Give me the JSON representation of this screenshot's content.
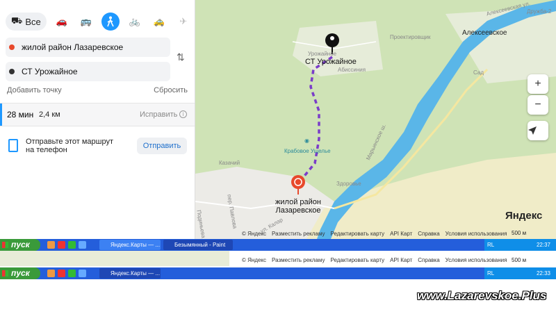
{
  "modes": {
    "all_label": "Все"
  },
  "route_from": "жилой район Лазаревское",
  "route_to": "СТ Урожайное",
  "add_point": "Добавить точку",
  "reset": "Сбросить",
  "route_info": {
    "time": "28 мин",
    "distance": "2,4 км",
    "fix": "Исправить"
  },
  "send": {
    "text": "Отправьте этот маршрут на телефон",
    "button": "Отправить"
  },
  "map": {
    "labels": [
      "Урожайное",
      "Абиссиния",
      "Проектировщик",
      "Алексеевское",
      "Алексеевская ул.",
      "Дружба-2",
      "Сад",
      "Марьинское ш.",
      "Казачий",
      "Здоровье",
      "пер. Павлова",
      "ул. Калар",
      "Подиньева"
    ],
    "pin_top": "СТ Урожайное",
    "pin_bottom": "жилой район Лазаревское",
    "crab": "Крабовое Ущелье",
    "logo": "Яндекс",
    "scale": "500 м",
    "footer": [
      "© Яндекс",
      "Условия использования",
      "Разместить рекламу",
      "Редактировать карту",
      "API Карт",
      "Справка"
    ]
  },
  "taskbar1": {
    "start": "пуск",
    "btn1": "Яндекс.Карты — ...",
    "btn2": "Безымянный - Paint",
    "lang": "RL",
    "clock": "22:37"
  },
  "taskbar2": {
    "start": "пуск",
    "btn1": "Яндекс.Карты — ...",
    "lang": "RL",
    "clock": "22:33"
  },
  "watermark": "www.Lazarevskoe.Plus",
  "colors": {
    "accent": "#1e98ff",
    "route": "#7a3cc9",
    "pin": "#e8492b",
    "water": "#5ab6e8",
    "forest": "#cfe3b6",
    "taskbar": "#245edb"
  }
}
